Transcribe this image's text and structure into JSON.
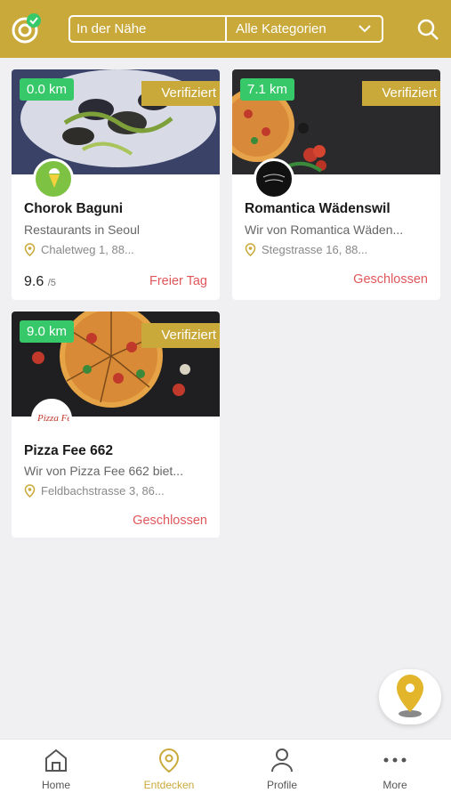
{
  "header": {
    "location_filter": "In der Nähe",
    "category_filter": "Alle Kategorien"
  },
  "cards": [
    {
      "distance": "0.0 km",
      "badge": "Verifiziert",
      "name": "Chorok Baguni",
      "description": "Restaurants in Seoul",
      "address": "Chaletweg 1, 88...",
      "rating": "9.6",
      "rating_max": "/5",
      "status": "Freier Tag"
    },
    {
      "distance": "7.1 km",
      "badge": "Verifiziert",
      "name": "Romantica Wädenswil",
      "description": "Wir von Romantica Wäden...",
      "address": "Stegstrasse 16, 88...",
      "status": "Geschlossen"
    },
    {
      "distance": "9.0 km",
      "badge": "Verifiziert",
      "name": "Pizza Fee 662",
      "description": "Wir von Pizza Fee 662 biet...",
      "address": "Feldbachstrasse 3, 86...",
      "status": "Geschlossen",
      "logo_text": "Pizza Fee"
    }
  ],
  "nav": {
    "home": "Home",
    "discover": "Entdecken",
    "profile": "Profile",
    "more": "More"
  },
  "colors": {
    "brand": "#c9a93a",
    "distance_badge": "#37c86a",
    "status": "#e0575b"
  }
}
